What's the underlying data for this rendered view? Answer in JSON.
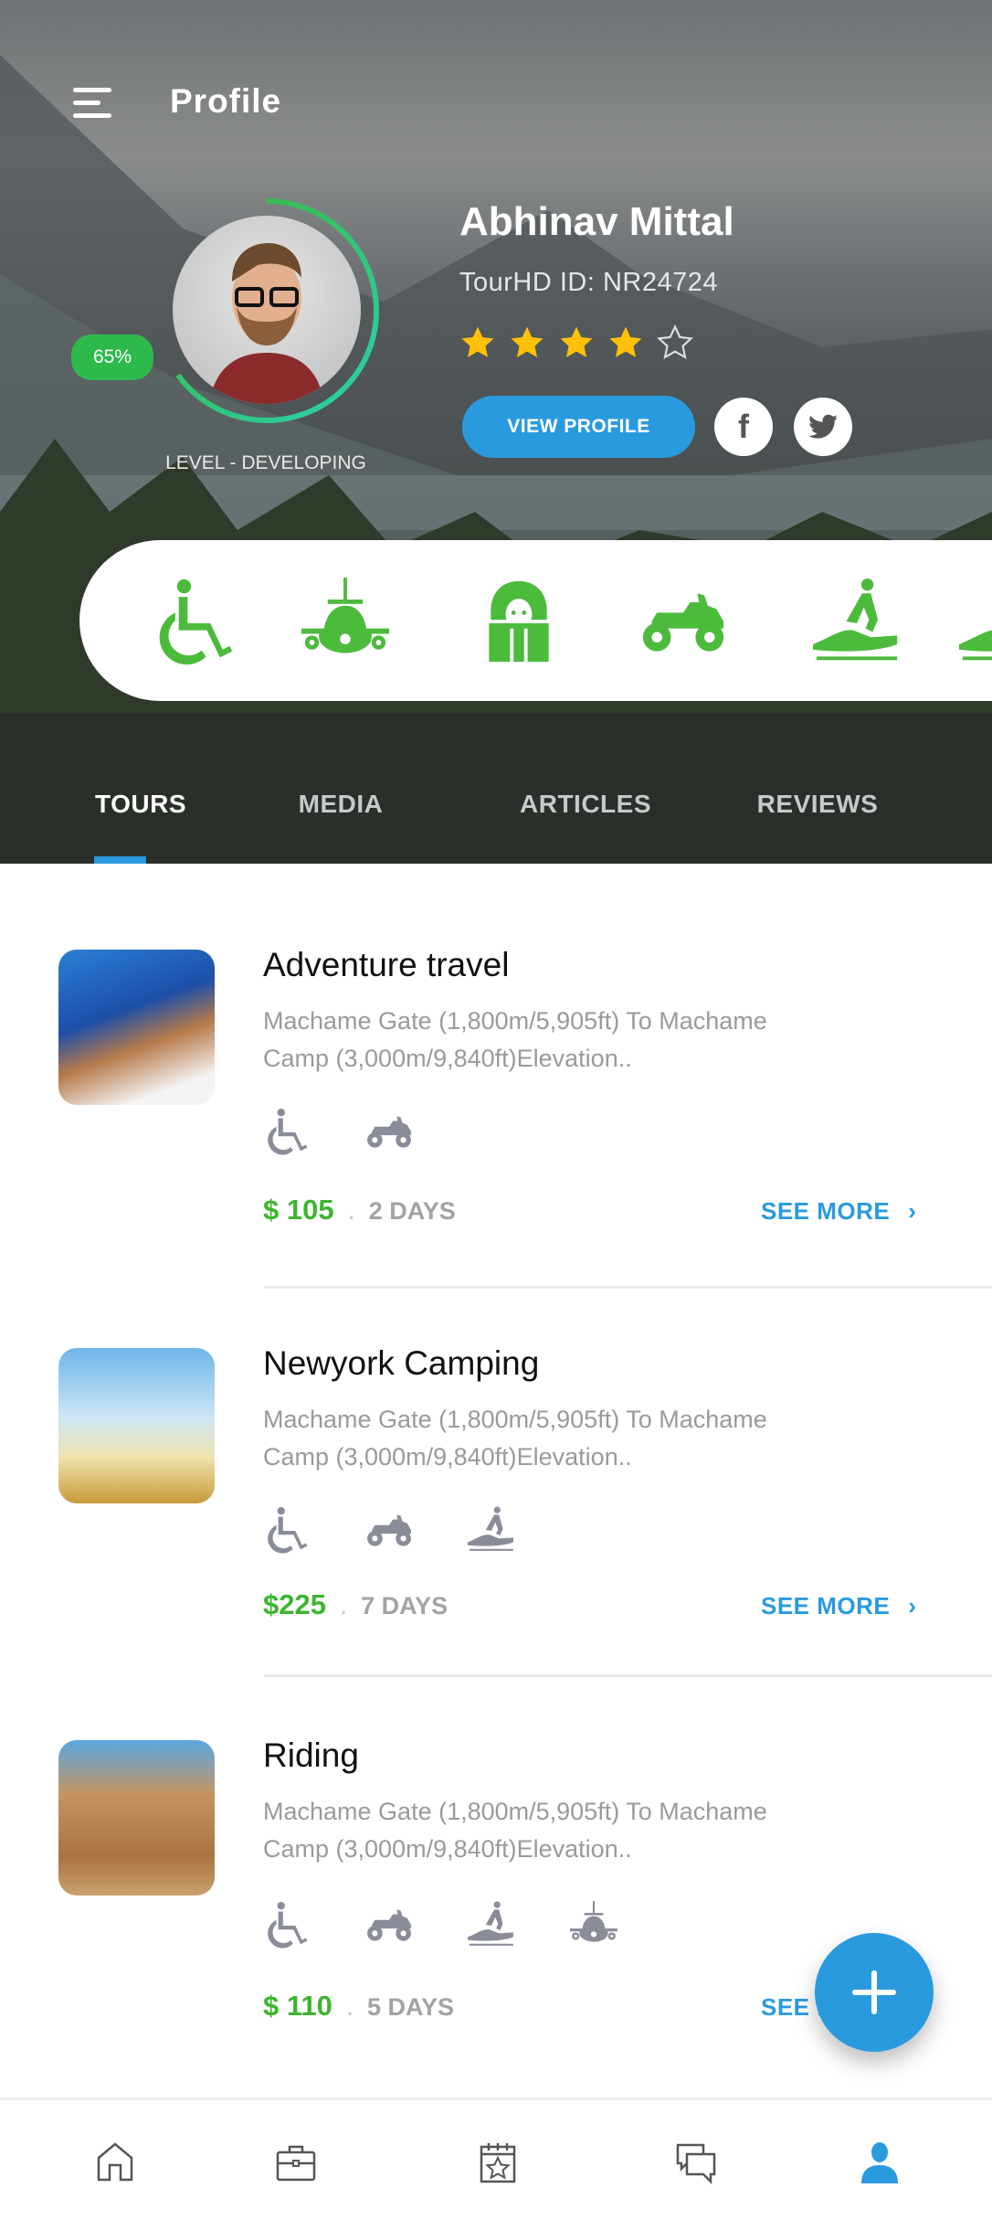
{
  "header": {
    "title": "Profile",
    "menu_icon": "hamburger-menu-icon"
  },
  "profile": {
    "name": "Abhinav Mittal",
    "tourhd_id": "TourHD ID: NR24724",
    "progress_label": "65%",
    "progress_percent": 65,
    "level": "LEVEL - DEVELOPING",
    "rating": 4,
    "rating_max": 5,
    "view_profile_label": "VIEW PROFILE",
    "social": [
      "facebook-icon",
      "twitter-icon"
    ]
  },
  "activities": [
    "wheelchair-icon",
    "airplane-icon",
    "pharaoh-icon",
    "atv-icon",
    "jetski-icon"
  ],
  "tabs": [
    {
      "label": "TOURS",
      "active": true
    },
    {
      "label": "MEDIA"
    },
    {
      "label": "ARTICLES"
    },
    {
      "label": "REVIEWS"
    }
  ],
  "tours": [
    {
      "title": "Adventure travel",
      "desc1": "Machame Gate (1,800m/5,905ft) To Machame",
      "desc2": "Camp (3,000m/9,840ft)Elevation..",
      "icons": [
        "wheelchair-icon",
        "atv-icon"
      ],
      "price": "$ 105",
      "days": "2 DAYS",
      "see_more": "SEE MORE"
    },
    {
      "title": "Newyork Camping",
      "desc1": "Machame Gate (1,800m/5,905ft) To Machame",
      "desc2": "Camp (3,000m/9,840ft)Elevation..",
      "icons": [
        "wheelchair-icon",
        "atv-icon",
        "jetski-icon"
      ],
      "price": "$225",
      "days": "7 DAYS",
      "see_more": "SEE MORE"
    },
    {
      "title": "Riding",
      "desc1": "Machame Gate (1,800m/5,905ft) To Machame",
      "desc2": "Camp (3,000m/9,840ft)Elevation..",
      "icons": [
        "wheelchair-icon",
        "atv-icon",
        "jetski-icon",
        "airplane-icon"
      ],
      "price": "$ 110",
      "days": "5 DAYS",
      "see_more": "SEE MORE"
    }
  ],
  "bottom_nav": [
    {
      "icon": "home-icon"
    },
    {
      "icon": "briefcase-icon"
    },
    {
      "icon": "calendar-star-icon"
    },
    {
      "icon": "chat-icon"
    },
    {
      "icon": "user-icon",
      "active": true
    }
  ],
  "colors": {
    "accent": "#2a9ade",
    "green": "#3cb52f",
    "icon_gray": "#8a8d99",
    "nav_gray": "#555555"
  }
}
